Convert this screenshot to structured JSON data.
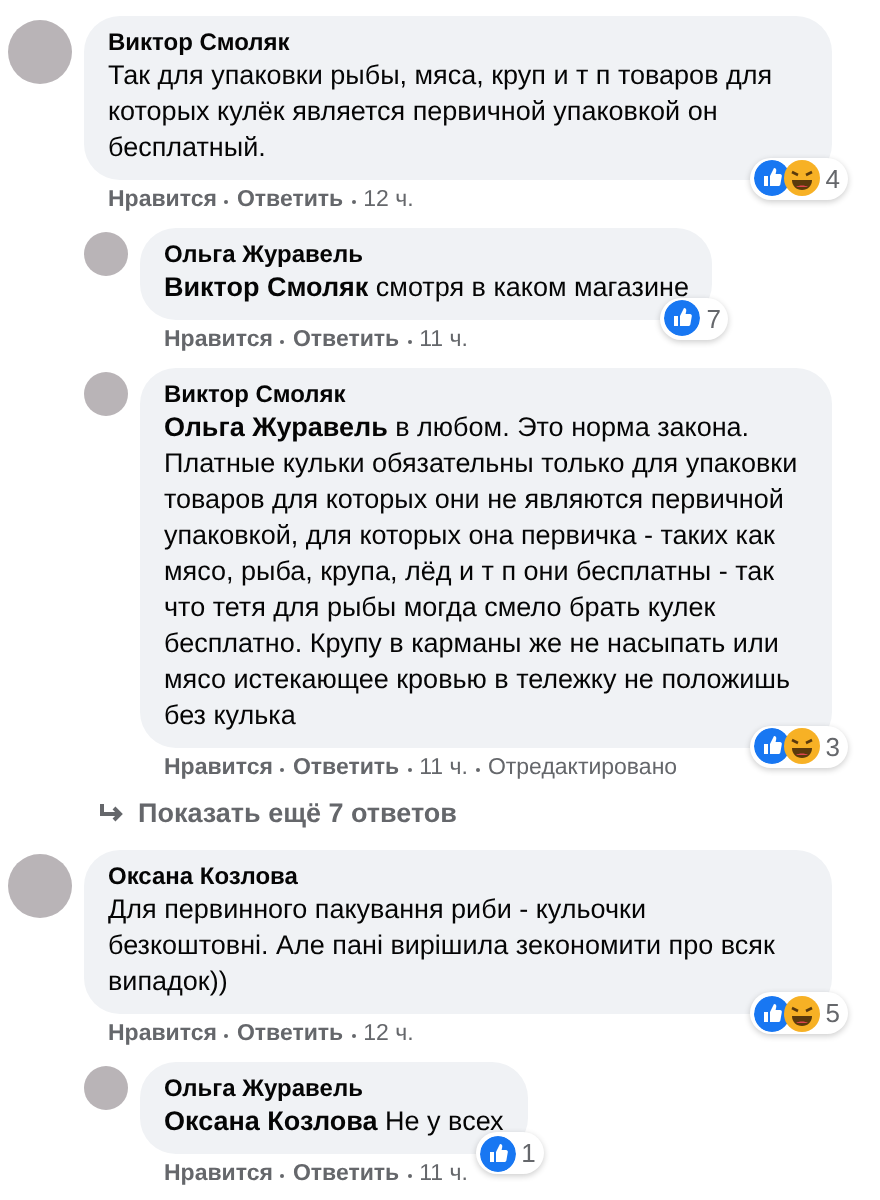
{
  "comments": [
    {
      "author": "Виктор Смоляк",
      "text": "Так для упаковки рыбы, мяса, круп и т п товаров для которых кулёк является первичной упаковкой он бесплатный.",
      "reactions": [
        {
          "kind": "like"
        },
        {
          "kind": "haha"
        }
      ],
      "reaction_count": "4",
      "actions": [
        "Нравится",
        "Ответить",
        "12 ч."
      ],
      "replies": [
        {
          "author": "Ольга Журавель",
          "text": "**Виктор Смоляк** смотря в каком магазине",
          "reactions": [
            {
              "kind": "like"
            }
          ],
          "reaction_count": "7",
          "actions": [
            "Нравится",
            "Ответить",
            "11 ч."
          ]
        },
        {
          "author": "Виктор Смоляк",
          "text": "**Ольга Журавель** в любом. Это норма закона. Платные кульки обязательны только для упаковки товаров для которых они не являются первичной упаковкой, для которых она первичка - таких как мясо, рыба, крупа, лёд и т п они бесплатны - так что тетя для рыбы могда смело брать кулек бесплатно. Крупу в карманы же не насыпать или мясо истекающее кровью в тележку не положишь без кулька",
          "reactions": [
            {
              "kind": "like"
            },
            {
              "kind": "haha"
            }
          ],
          "reaction_count": "3",
          "actions": [
            "Нравится",
            "Ответить",
            "11 ч.",
            "Отредактировано"
          ]
        }
      ],
      "more_replies": "Показать ещё 7 ответов"
    },
    {
      "author": "Оксана Козлова",
      "text": "Для первинного пакування риби - кульочки безкоштовні. Але пані вирішила зекономити про всяк випадок))",
      "reactions": [
        {
          "kind": "like"
        },
        {
          "kind": "haha"
        }
      ],
      "reaction_count": "5",
      "actions": [
        "Нравится",
        "Ответить",
        "12 ч."
      ],
      "replies": [
        {
          "author": "Ольга Журавель",
          "text": "**Оксана Козлова** Не у всех",
          "reactions": [
            {
              "kind": "like"
            }
          ],
          "reaction_count": "1",
          "actions": [
            "Нравится",
            "Ответить",
            "11 ч."
          ]
        }
      ]
    }
  ]
}
